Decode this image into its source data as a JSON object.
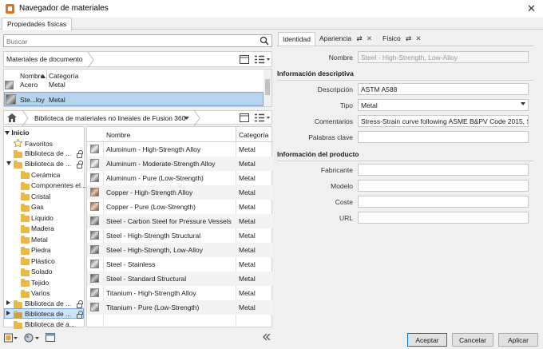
{
  "window": {
    "title": "Navegador de materiales"
  },
  "top_tab": "Propiedades físicas",
  "search": {
    "placeholder": "Buscar"
  },
  "document_materials": {
    "title": "Materiales de documento",
    "columns": [
      "Nombre",
      "Categoría"
    ],
    "rows": [
      {
        "name": "Acero",
        "category": "Metal"
      },
      {
        "name": "Ste...loy",
        "category": "Metal"
      }
    ]
  },
  "library": {
    "name": "Biblioteca de materiales no lineales de Fusion 360",
    "tree": {
      "root": "Inicio",
      "favorites": "Favoritos",
      "items": [
        "Biblioteca de ...",
        "Biblioteca de ..."
      ],
      "categories": [
        "Cerámica",
        "Componentes el...",
        "Cristal",
        "Gas",
        "Líquido",
        "Madera",
        "Metal",
        "Piedra",
        "Plástico",
        "Solado",
        "Tejido",
        "Varios"
      ],
      "bottom_items": [
        "Biblioteca de ...",
        "Biblioteca de ...",
        "Biblioteca de a..."
      ]
    },
    "columns": [
      "Nombre",
      "Categoría"
    ],
    "materials": [
      {
        "name": "Aluminum - High-Strength Alloy",
        "category": "Metal"
      },
      {
        "name": "Aluminum - Moderate-Strength Alloy",
        "category": "Metal"
      },
      {
        "name": "Aluminum - Pure (Low-Strength)",
        "category": "Metal"
      },
      {
        "name": "Copper - High-Strength Alloy",
        "category": "Metal"
      },
      {
        "name": "Copper - Pure (Low-Strength)",
        "category": "Metal"
      },
      {
        "name": "Steel - Carbon Steel for Pressure Vessels",
        "category": "Metal"
      },
      {
        "name": "Steel - High-Strength Structural",
        "category": "Metal"
      },
      {
        "name": "Steel - High-Strength, Low-Alloy",
        "category": "Metal"
      },
      {
        "name": "Steel - Stainless",
        "category": "Metal"
      },
      {
        "name": "Steel - Standard Structural",
        "category": "Metal"
      },
      {
        "name": "Titanium - High-Strength Alloy",
        "category": "Metal"
      },
      {
        "name": "Titanium - Pure (Low-Strength)",
        "category": "Metal"
      }
    ]
  },
  "detail_tabs": [
    "Identidad",
    "Apariencia",
    "Físico"
  ],
  "identity": {
    "name_label": "Nombre",
    "name_value": "Steel - High-Strength, Low-Alloy",
    "desc_section": "Información descriptiva",
    "description_label": "Descripción",
    "description_value": "ASTM A588",
    "type_label": "Tipo",
    "type_value": "Metal",
    "comments_label": "Comentarios",
    "comments_value": "Stress-Strain curve following ASME B&PV Code 2015, S...",
    "keywords_label": "Palabras clave",
    "keywords_value": "",
    "product_section": "Información del producto",
    "manufacturer_label": "Fabricante",
    "model_label": "Modelo",
    "cost_label": "Coste",
    "url_label": "URL"
  },
  "buttons": {
    "accept": "Aceptar",
    "cancel": "Cancelar",
    "apply": "Aplicar"
  }
}
